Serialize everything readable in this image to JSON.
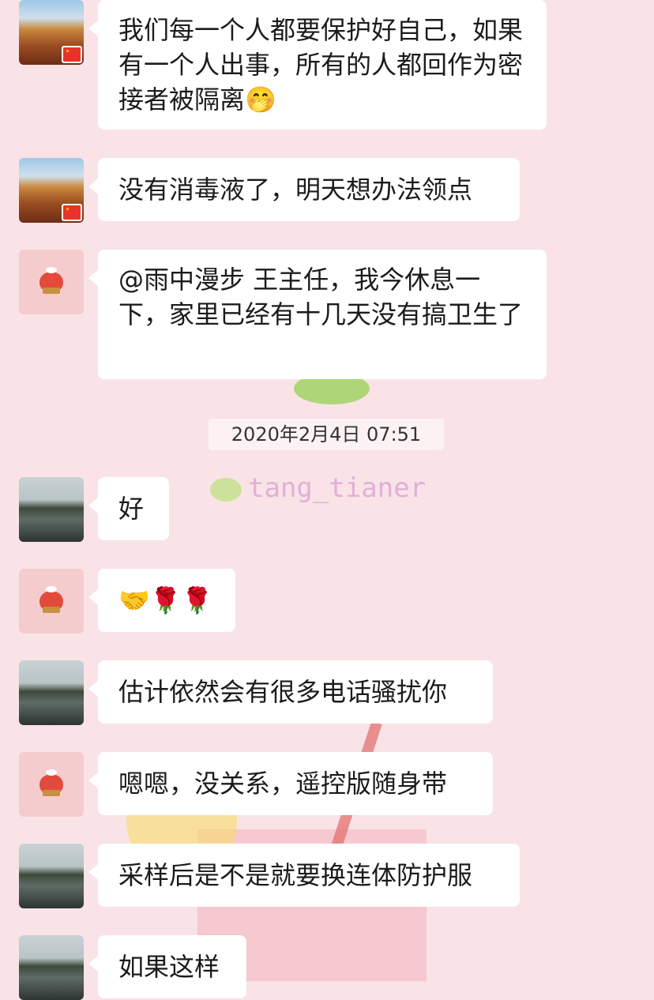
{
  "timestamp": "2020年2月4日 07:51",
  "watermark": {
    "handle": "tang_tianer"
  },
  "messages": [
    {
      "text": "我们每一个人都要保护好自己，如果有一个人出事，所有的人都回作为密接者被隔离🤭",
      "avatar": "canyon-avatar"
    },
    {
      "text": "没有消毒液了，明天想办法领点",
      "avatar": "canyon-avatar"
    },
    {
      "text": "@雨中漫步 王主任，我今休息一下，家里已经有十几天没有搞卫生了",
      "avatar": "fruit-avatar"
    },
    {
      "text": "好",
      "avatar": "river-avatar"
    },
    {
      "text": "🤝🌹🌹",
      "avatar": "fruit-avatar"
    },
    {
      "text": "估计依然会有很多电话骚扰你",
      "avatar": "river-avatar"
    },
    {
      "text": "嗯嗯，没关系，遥控版随身带",
      "avatar": "fruit-avatar"
    },
    {
      "text": "采样后是不是就要换连体防护服",
      "avatar": "river-avatar"
    },
    {
      "text": "如果这样",
      "avatar": "river-avatar"
    }
  ]
}
